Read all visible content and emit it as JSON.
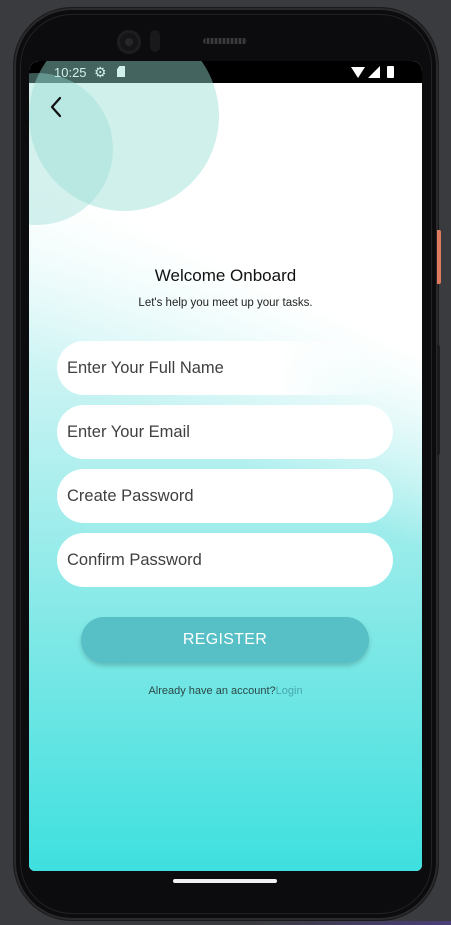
{
  "status_bar": {
    "time": "10:25",
    "icons": [
      "gear-icon",
      "sd-card-icon",
      "wifi-icon",
      "signal-icon",
      "battery-icon"
    ]
  },
  "header": {
    "back_icon": "chevron-left-icon"
  },
  "main": {
    "title": "Welcome Onboard",
    "subtitle": "Let's help you meet up your tasks."
  },
  "form": {
    "full_name": {
      "value": "",
      "placeholder": "Enter Your Full Name"
    },
    "email": {
      "value": "",
      "placeholder": "Enter Your Email"
    },
    "password": {
      "value": "",
      "placeholder": "Create Password"
    },
    "confirm_password": {
      "value": "",
      "placeholder": "Confirm Password"
    },
    "register_label": "REGISTER"
  },
  "footer": {
    "prompt": "Already have an account?",
    "login_label": "Login"
  },
  "colors": {
    "accent": "#57bfc6",
    "link": "#4aa8ac",
    "gradient_end": "#3ee0df",
    "circle": "#96ddd4"
  }
}
